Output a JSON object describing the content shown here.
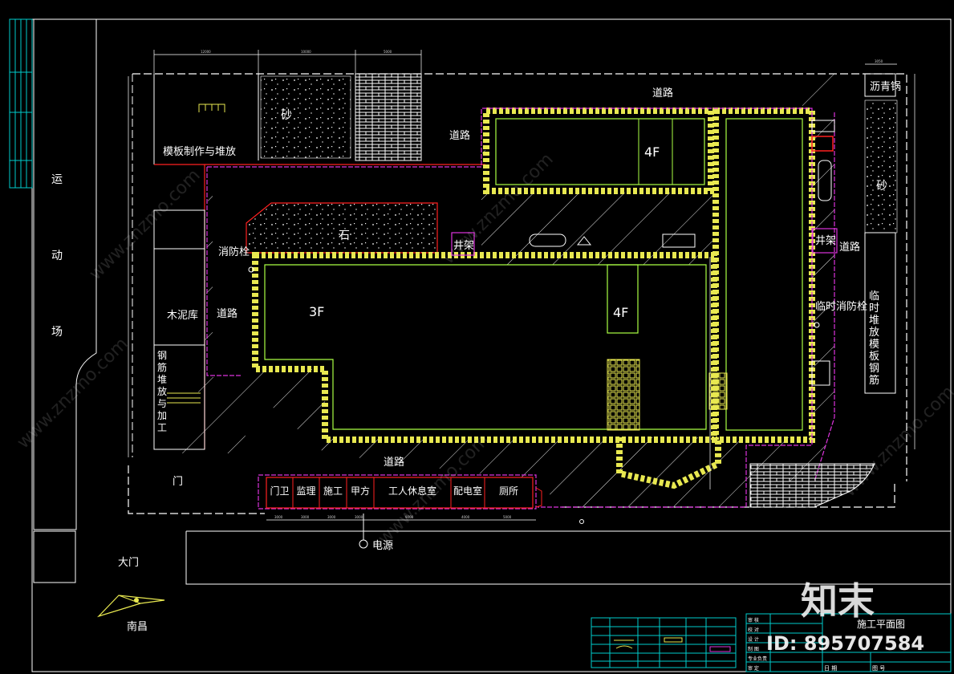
{
  "labels": {
    "road": "道路",
    "sand": "砂",
    "formwork_yard": "模板制作与堆放",
    "stone": "石",
    "hoist": "井架",
    "hydrant": "消防栓",
    "temp_hydrant": "临时消防栓",
    "cement": "木泥库",
    "rebar": "钢筋堆放与加工",
    "asphalt": "沥青锅",
    "temp_storage": "临时堆放模板钢筋",
    "bldg_3f": "3F",
    "bldg_4f": "4F",
    "sports_ground": "运动场",
    "gate_small": "门",
    "main_gate": "大门",
    "power": "电源",
    "nanchang": "南昌"
  },
  "sheds": [
    "门卫",
    "监理",
    "施工",
    "甲方",
    "工人休息室",
    "配电室",
    "厕所"
  ],
  "title_block": {
    "drawing_title": "施工平面图",
    "row_labels": [
      "审 核",
      "校 对",
      "设 计",
      "制 图",
      "专业负责",
      "审 定"
    ],
    "date_label": "日 期",
    "number_label": "图 号"
  },
  "watermark": {
    "brand": "知末",
    "site": "www.znzmo.com",
    "id_text": "ID: 895707584"
  },
  "colors": {
    "background": "#000000",
    "line_white": "#ffffff",
    "building_green": "#aaff44",
    "yellow": "#e8e850",
    "boundary_magenta": "#dd33dd",
    "red": "#ff2020",
    "cyan_frame": "#00cccc"
  }
}
